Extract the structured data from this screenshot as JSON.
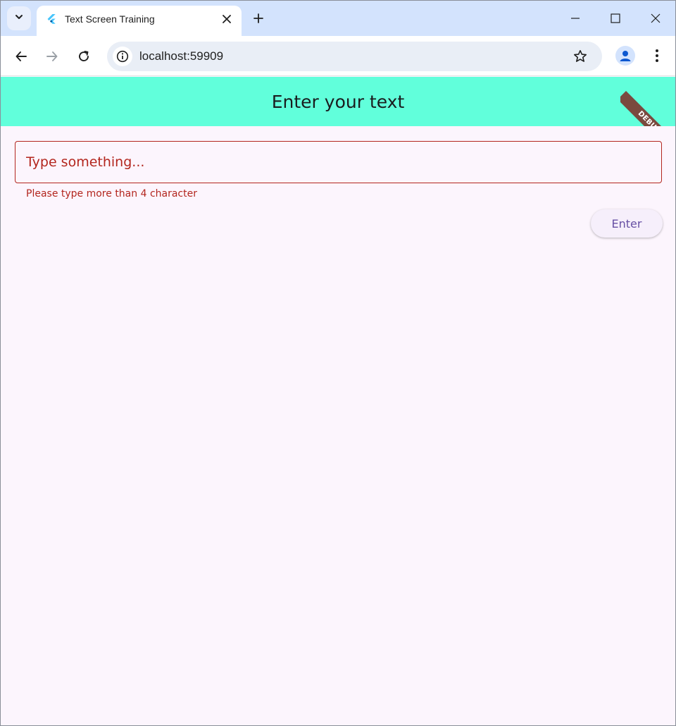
{
  "browser": {
    "tab_title": "Text Screen Training",
    "url": "localhost:59909"
  },
  "icons": {
    "tab_search": "chevron-down-icon",
    "favicon": "flutter-icon",
    "tab_close": "close-icon",
    "new_tab": "plus-icon",
    "minimize": "minimize-icon",
    "maximize": "maximize-icon",
    "window_close": "close-icon",
    "back": "arrow-left-icon",
    "forward": "arrow-right-icon",
    "reload": "reload-icon",
    "site_info": "info-icon",
    "bookmark": "star-icon",
    "profile": "person-icon",
    "menu": "more-vert-icon"
  },
  "app": {
    "title": "Enter your text",
    "debug_label": "DEBUG",
    "input": {
      "placeholder": "Type something...",
      "value": ""
    },
    "error_message": "Please type more than 4 character",
    "enter_button": "Enter"
  },
  "colors": {
    "tabstrip": "#d3e3fd",
    "appbar": "#61ffdb",
    "page_background": "#fcf5fd",
    "error": "#b3261e",
    "button_text": "#6750a4",
    "debug_banner": "#7a4a3f"
  }
}
